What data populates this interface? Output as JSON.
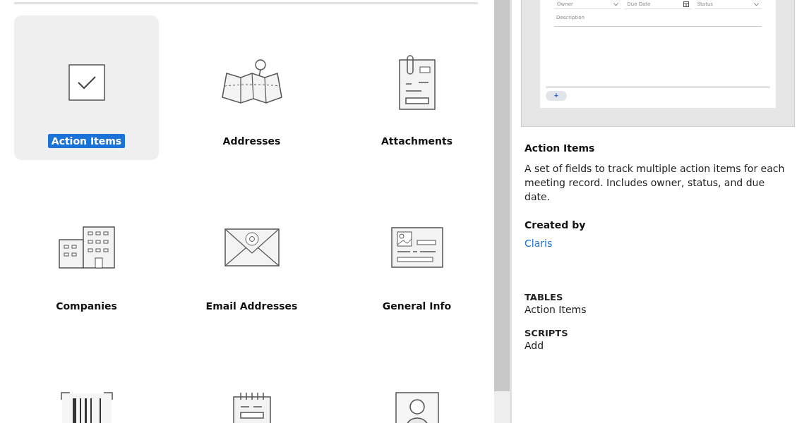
{
  "addons": [
    {
      "label": "Action Items",
      "selected": true
    },
    {
      "label": "Addresses",
      "selected": false
    },
    {
      "label": "Attachments",
      "selected": false
    },
    {
      "label": "Companies",
      "selected": false
    },
    {
      "label": "Email Addresses",
      "selected": false
    },
    {
      "label": "General Info",
      "selected": false
    },
    {
      "selected": false
    },
    {
      "selected": false
    },
    {
      "selected": false
    }
  ],
  "preview": {
    "fields": [
      {
        "label": "Owner",
        "kind": "dropdown"
      },
      {
        "label": "Due Date",
        "kind": "date"
      },
      {
        "label": "Status",
        "kind": "dropdown"
      }
    ],
    "description": "Description",
    "add_button": "+"
  },
  "details": {
    "title": "Action Items",
    "description": "A set of fields to track multiple action items for each meeting record. Includes owner, status, and due date.",
    "created_by_label": "Created by",
    "creator": "Claris",
    "sections": [
      {
        "heading": "TABLES",
        "value": "Action Items"
      },
      {
        "heading": "SCRIPTS",
        "value": "Add"
      }
    ]
  }
}
